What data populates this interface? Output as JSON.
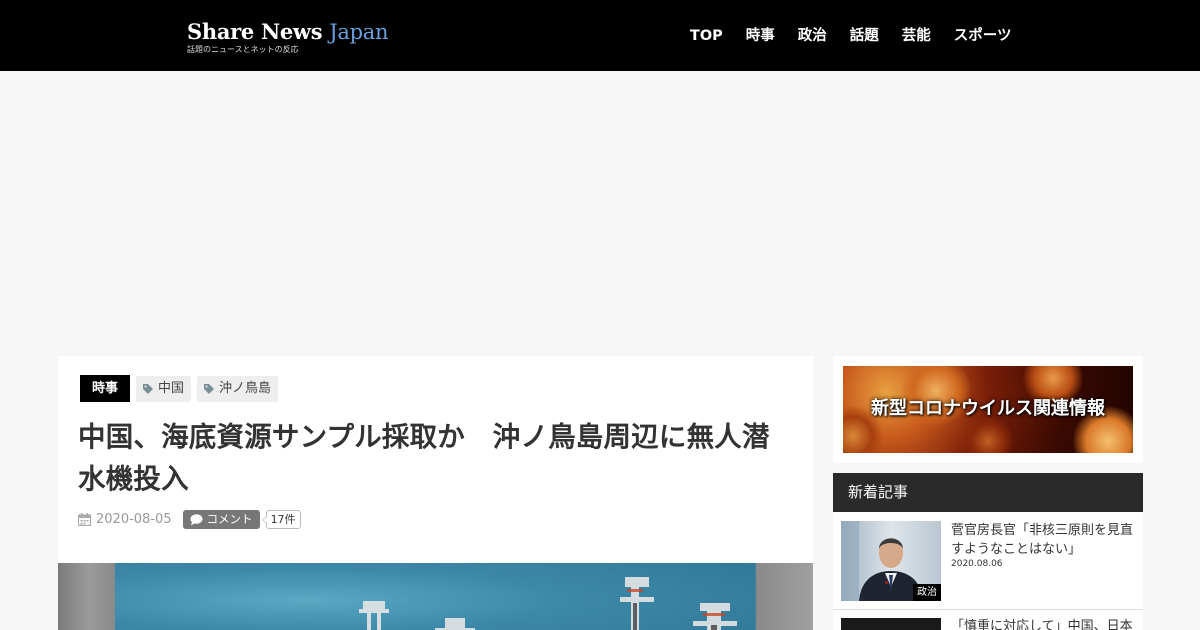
{
  "header": {
    "logo_main": "Share News",
    "logo_accent": "Japan",
    "logo_sub": "話題のニュースとネットの反応",
    "nav": [
      "TOP",
      "時事",
      "政治",
      "話題",
      "芸能",
      "スポーツ"
    ]
  },
  "article": {
    "category": "時事",
    "tags": [
      "中国",
      "沖ノ鳥島"
    ],
    "title": "中国、海底資源サンプル採取か　沖ノ鳥島周辺に無人潜水機投入",
    "date": "2020-08-05",
    "comment_label": "コメント",
    "comment_count": "17件"
  },
  "sidebar": {
    "banner_text": "新型コロナウイルス関連情報",
    "new_heading": "新着記事",
    "items": [
      {
        "title": "菅官房長官「非核三原則を見直すようなことはない」",
        "date": "2020.08.06",
        "category": "政治"
      },
      {
        "title": "「慎重に対応して」中国、日本",
        "date": "",
        "category": ""
      }
    ]
  },
  "colors": {
    "header_bg": "#000000",
    "logo_accent": "#6aa0dc",
    "sidebar_heading_bg": "#2a2a2a"
  }
}
